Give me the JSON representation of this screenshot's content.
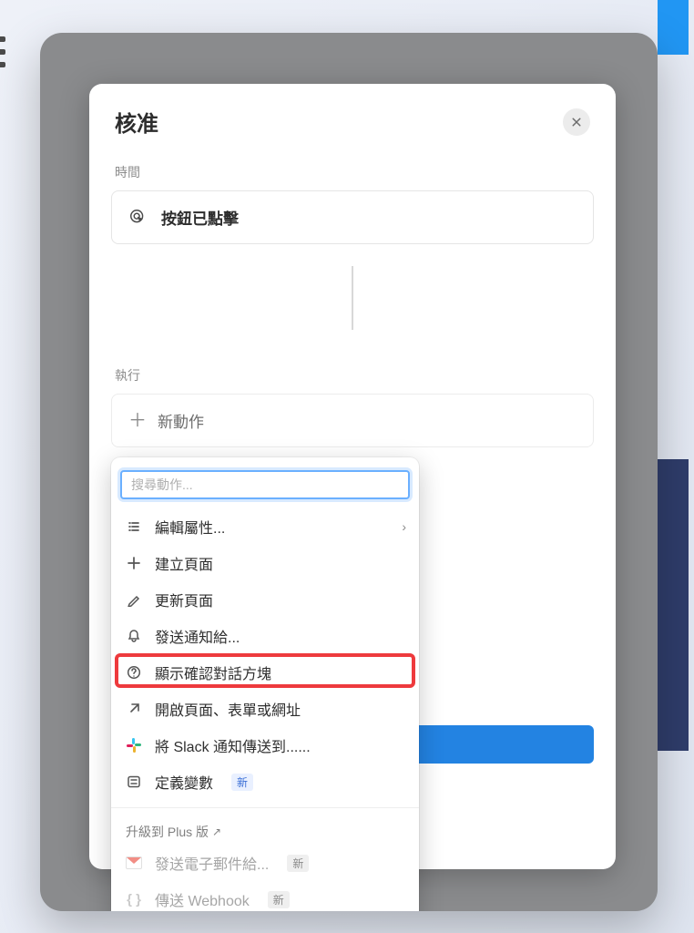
{
  "modal": {
    "title": "核准",
    "section_time": "時間",
    "trigger_text": "按鈕已點擊",
    "section_execute": "執行",
    "new_action": "新動作"
  },
  "dropdown": {
    "search_placeholder": "搜尋動作...",
    "items": {
      "edit_props": "編輯屬性...",
      "create_page": "建立頁面",
      "update_page": "更新頁面",
      "send_notif": "發送通知給...",
      "show_confirm": "顯示確認對話方塊",
      "open_page": "開啟頁面、表單或網址",
      "slack": "將 Slack 通知傳送到......",
      "define_var": "定義變數"
    },
    "upgrade_label": "升級到 Plus 版",
    "plus_items": {
      "email": "發送電子郵件給...",
      "webhook": "傳送 Webhook"
    },
    "badge_new": "新"
  }
}
